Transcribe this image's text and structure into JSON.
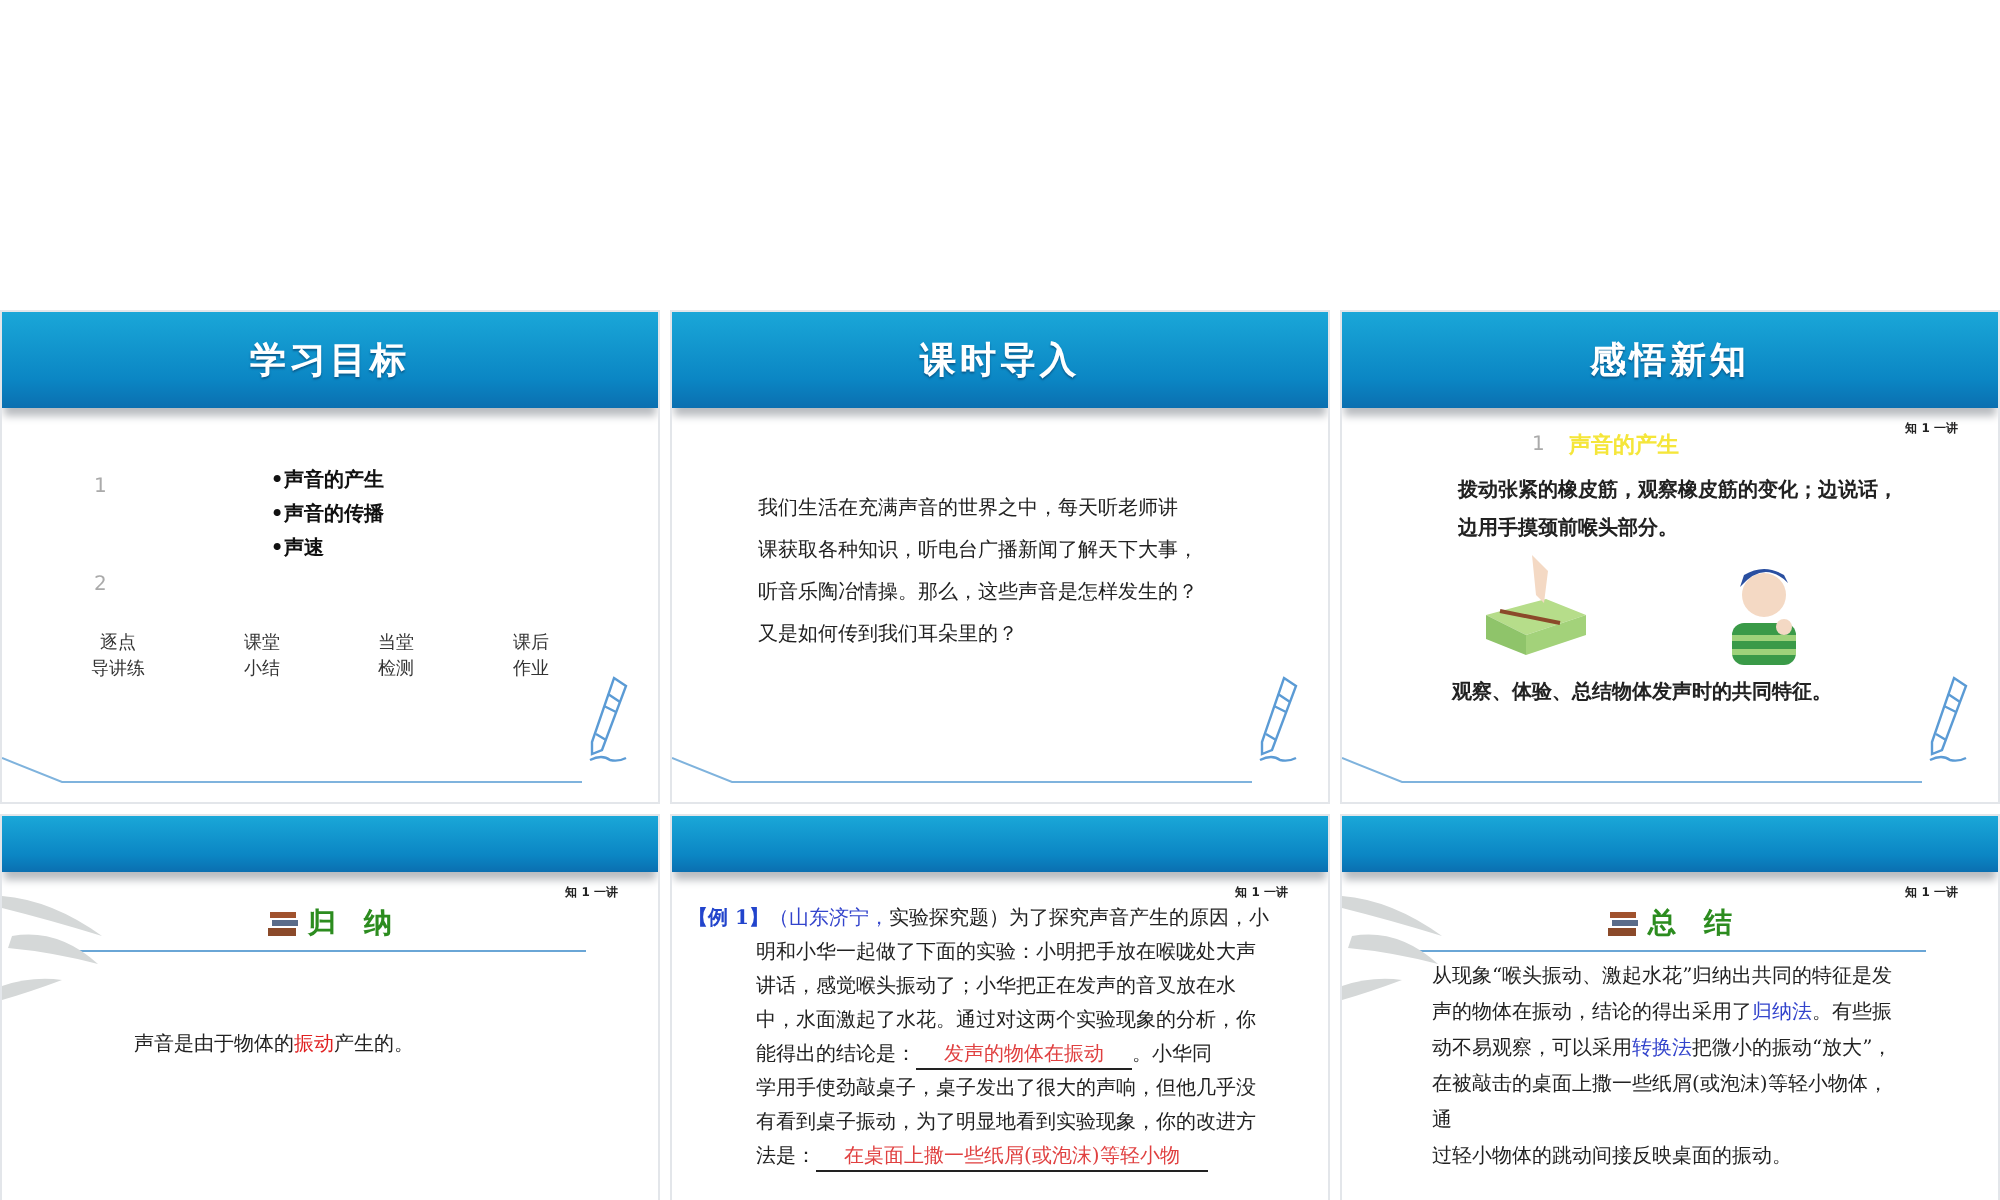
{
  "slides": [
    {
      "kind": "goals",
      "title": "学习目标",
      "numbers": [
        "1",
        "2"
      ],
      "bullets": [
        "•声音的产生",
        "•声音的传播",
        "•声速"
      ],
      "nav": [
        [
          "逐点",
          "导讲练"
        ],
        [
          "课堂",
          "小结"
        ],
        [
          "当堂",
          "检测"
        ],
        [
          "课后",
          "作业"
        ]
      ]
    },
    {
      "kind": "intro",
      "title": "课时导入",
      "lines": [
        "我们生活在充满声音的世界之中，每天听老师讲",
        "课获取各种知识，听电台广播新闻了解天下大事，",
        "听音乐陶冶情操。那么，这些声音是怎样发生的？",
        "又是如何传到我们耳朵里的？"
      ]
    },
    {
      "kind": "new",
      "title": "感悟新知",
      "tag": "知 1 一讲",
      "number": "1",
      "section": "声音的产生",
      "lines": [
        "拨动张紧的橡皮筋，观察橡皮筋的变化；边说话，",
        "边用手摸颈前喉头部分。"
      ],
      "caption": "观察、体验、总结物体发声时的共同特征。"
    },
    {
      "kind": "summary",
      "tag": "知 1 一讲",
      "heading": "归　纳",
      "lines": [
        [
          {
            "t": "声音是由于物体的",
            "kind": "plain"
          },
          {
            "t": "振动",
            "kind": "answer"
          },
          {
            "t": "产生的。",
            "kind": "plain"
          }
        ]
      ]
    },
    {
      "kind": "example",
      "tag": "知 1 一讲",
      "lines": [
        [
          {
            "t": "【例 1】",
            "kind": "label"
          },
          {
            "t": "（山东济宁，",
            "kind": "source"
          },
          {
            "t": "实验探究题）为了探究声音产生的原因，小",
            "kind": "plain"
          }
        ],
        [
          {
            "t": "明和小华一起做了下面的实验：小明把手放在喉咙处大声",
            "kind": "plain"
          }
        ],
        [
          {
            "t": "讲话，感觉喉头振动了；小华把正在发声的音叉放在水",
            "kind": "plain"
          }
        ],
        [
          {
            "t": "中，水面激起了水花。通过对这两个实验现象的分析，你",
            "kind": "plain"
          }
        ],
        [
          {
            "t": "能得出的结论是：",
            "kind": "plain"
          },
          {
            "t": "发声的物体在振动",
            "kind": "blank"
          },
          {
            "t": "。小华同",
            "kind": "plain"
          }
        ],
        [
          {
            "t": "学用手使劲敲桌子，桌子发出了很大的声响，但他几乎没",
            "kind": "plain"
          }
        ],
        [
          {
            "t": "有看到桌子振动，为了明显地看到实验现象，你的改进方",
            "kind": "plain"
          }
        ],
        [
          {
            "t": "法是：",
            "kind": "plain"
          },
          {
            "t": "在桌面上撒一些纸屑(或泡沫)等轻小物",
            "kind": "blank"
          }
        ]
      ]
    },
    {
      "kind": "summary",
      "tag": "知 1 一讲",
      "heading": "总　结",
      "lines": [
        [
          {
            "t": "从现象“喉头振动、激起水花”归纳出共同的特征是发",
            "kind": "plain"
          }
        ],
        [
          {
            "t": "声的物体在振动，结论的得出采用了",
            "kind": "plain"
          },
          {
            "t": "归纳法",
            "kind": "source"
          },
          {
            "t": "。有些振",
            "kind": "plain"
          }
        ],
        [
          {
            "t": "动不易观察，可以采用",
            "kind": "plain"
          },
          {
            "t": "转换法",
            "kind": "source"
          },
          {
            "t": "把微小的振动“放大”，",
            "kind": "plain"
          }
        ],
        [
          {
            "t": "在被敲击的桌面上撒一些纸屑(或泡沫)等轻小物体，",
            "kind": "plain"
          }
        ],
        [
          {
            "t": "通",
            "kind": "plain"
          }
        ],
        [
          {
            "t": "过轻小物体的跳动间接反映桌面的振动。",
            "kind": "plain"
          }
        ]
      ]
    }
  ]
}
